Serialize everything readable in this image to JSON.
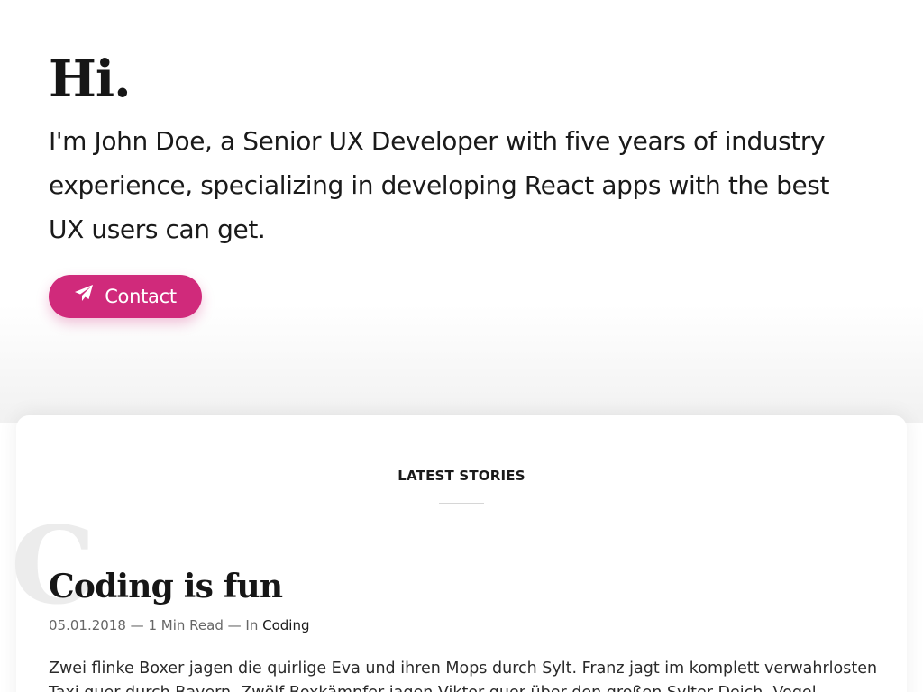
{
  "hero": {
    "greeting": "Hi.",
    "intro": "I'm John Doe, a Senior UX Developer with five years of industry experience, specializing in developing React apps with the best UX users can get.",
    "contact_button": {
      "label": "Contact",
      "icon": "paper-plane-icon"
    }
  },
  "stories": {
    "section_title": "LATEST STORIES",
    "items": [
      {
        "initial": "C",
        "title": "Coding is fun",
        "date": "05.01.2018",
        "separator": "—",
        "read_time": "1 Min Read",
        "category_prefix": "In",
        "category": "Coding",
        "excerpt": "Zwei flinke Boxer jagen die quirlige Eva und ihren Mops durch Sylt. Franz jagt im komplett verwahrlosten Taxi quer durch Bayern. Zwölf Boxkämpfer jagen Viktor quer über den großen Sylter Deich. Vogel"
      }
    ]
  },
  "colors": {
    "accent": "#d02a7b",
    "text": "#1a1a1a",
    "muted": "#666666",
    "background": "#ffffff"
  }
}
